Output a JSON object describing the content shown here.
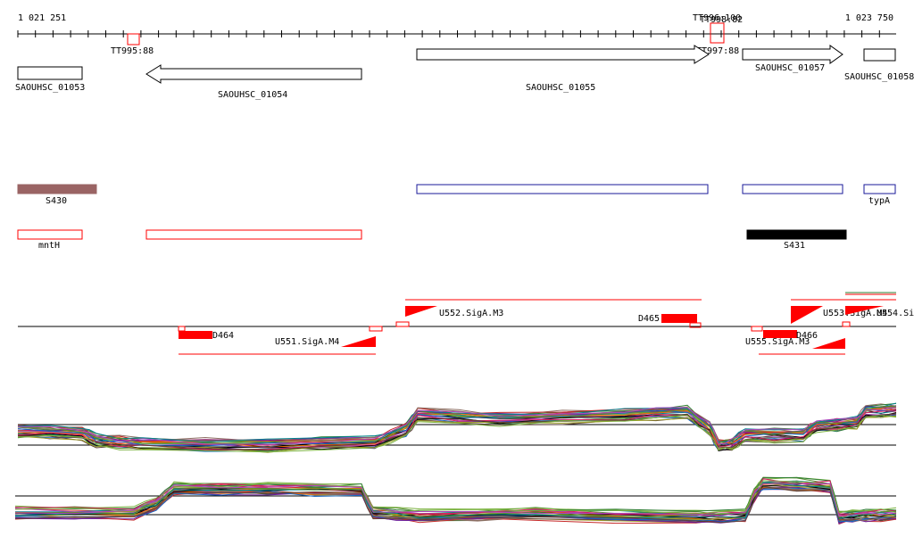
{
  "ruler": {
    "start_label": "1 021 251",
    "end_label": "1 023 750"
  },
  "terminators": [
    {
      "label": "TT995:88"
    },
    {
      "label": "TT997:88"
    },
    {
      "label": "TT996:100"
    },
    {
      "label": "TT998:82"
    }
  ],
  "genes": [
    {
      "label": "SAOUHSC_01053",
      "strand": "none"
    },
    {
      "label": "SAOUHSC_01054",
      "strand": "minus"
    },
    {
      "label": "SAOUHSC_01055",
      "strand": "plus"
    },
    {
      "label": "SAOUHSC_01057",
      "strand": "plus"
    },
    {
      "label": "SAOUHSC_01058",
      "strand": "none"
    }
  ],
  "annotation_track_1": {
    "features": [
      {
        "label": "S430",
        "color": "#9a6464",
        "style": "filled"
      },
      {
        "label": "",
        "color": "#1a1a9a",
        "style": "outline"
      },
      {
        "label": "",
        "color": "#1a1a9a",
        "style": "outline"
      },
      {
        "label": "typA",
        "color": "#1a1a9a",
        "style": "outline"
      }
    ]
  },
  "annotation_track_2": {
    "features": [
      {
        "label": "mntH",
        "color": "#ff0000",
        "style": "outline"
      },
      {
        "label": "",
        "color": "#ff0000",
        "style": "outline"
      },
      {
        "label": "S431",
        "color": "#000000",
        "style": "filled"
      }
    ]
  },
  "regulatory_track": {
    "promoters": [
      {
        "label": "U551.SigA.M4"
      },
      {
        "label": "U552.SigA.M3"
      },
      {
        "label": "U553.SigA.M4"
      },
      {
        "label": "U554.Si"
      },
      {
        "label": "U555.SigA.M3"
      }
    ],
    "downshifts": [
      {
        "label": "D464"
      },
      {
        "label": "D465"
      },
      {
        "label": "D466"
      }
    ]
  },
  "expression_panels": {
    "panel_count": 2,
    "series_colors": [
      "#2e7d32",
      "#c62828",
      "#6a1b9a",
      "#ef6c00",
      "#1565c0",
      "#8d6e63",
      "#000000",
      "#9e9d24",
      "#00838f",
      "#d81b60",
      "#558b2f",
      "#5d4037",
      "#7cb342",
      "#ab47bc"
    ]
  }
}
